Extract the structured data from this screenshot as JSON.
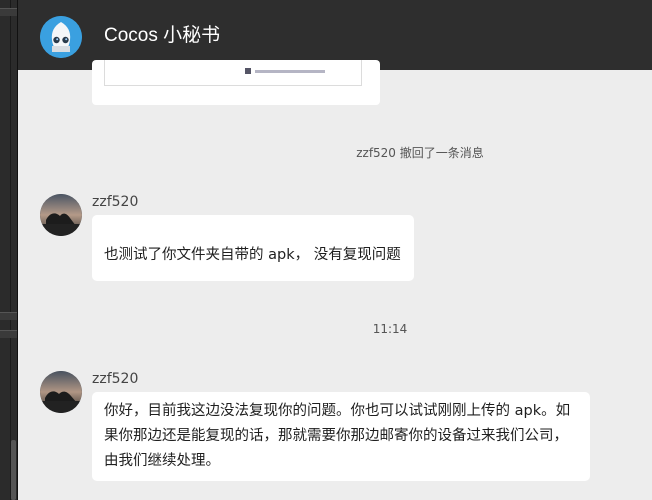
{
  "header": {
    "title": "Cocos 小秘书",
    "avatar_icon": "cocos-mascot-icon",
    "bg": "#2e2e2e"
  },
  "system_messages": {
    "recall": "zzf520 撤回了一条消息",
    "time": "11:14"
  },
  "messages": [
    {
      "sender": "zzf520",
      "avatar_icon": "sunset-avatar",
      "text": "也测试了你文件夹自带的 apk，  没有复现问题"
    },
    {
      "sender": "zzf520",
      "avatar_icon": "sunset-avatar",
      "lines": [
        "你好，目前我这边没法复现你的问题。你也可以试试刚刚上传的 apk。如",
        "果你那边还是能复现的话，那就需要你那边邮寄你的设备过来我们公司，",
        "由我们继续处理。"
      ]
    }
  ],
  "colors": {
    "chat_bg": "#ededed",
    "bubble": "#ffffff",
    "brand_blue": "#3aa0e0"
  }
}
